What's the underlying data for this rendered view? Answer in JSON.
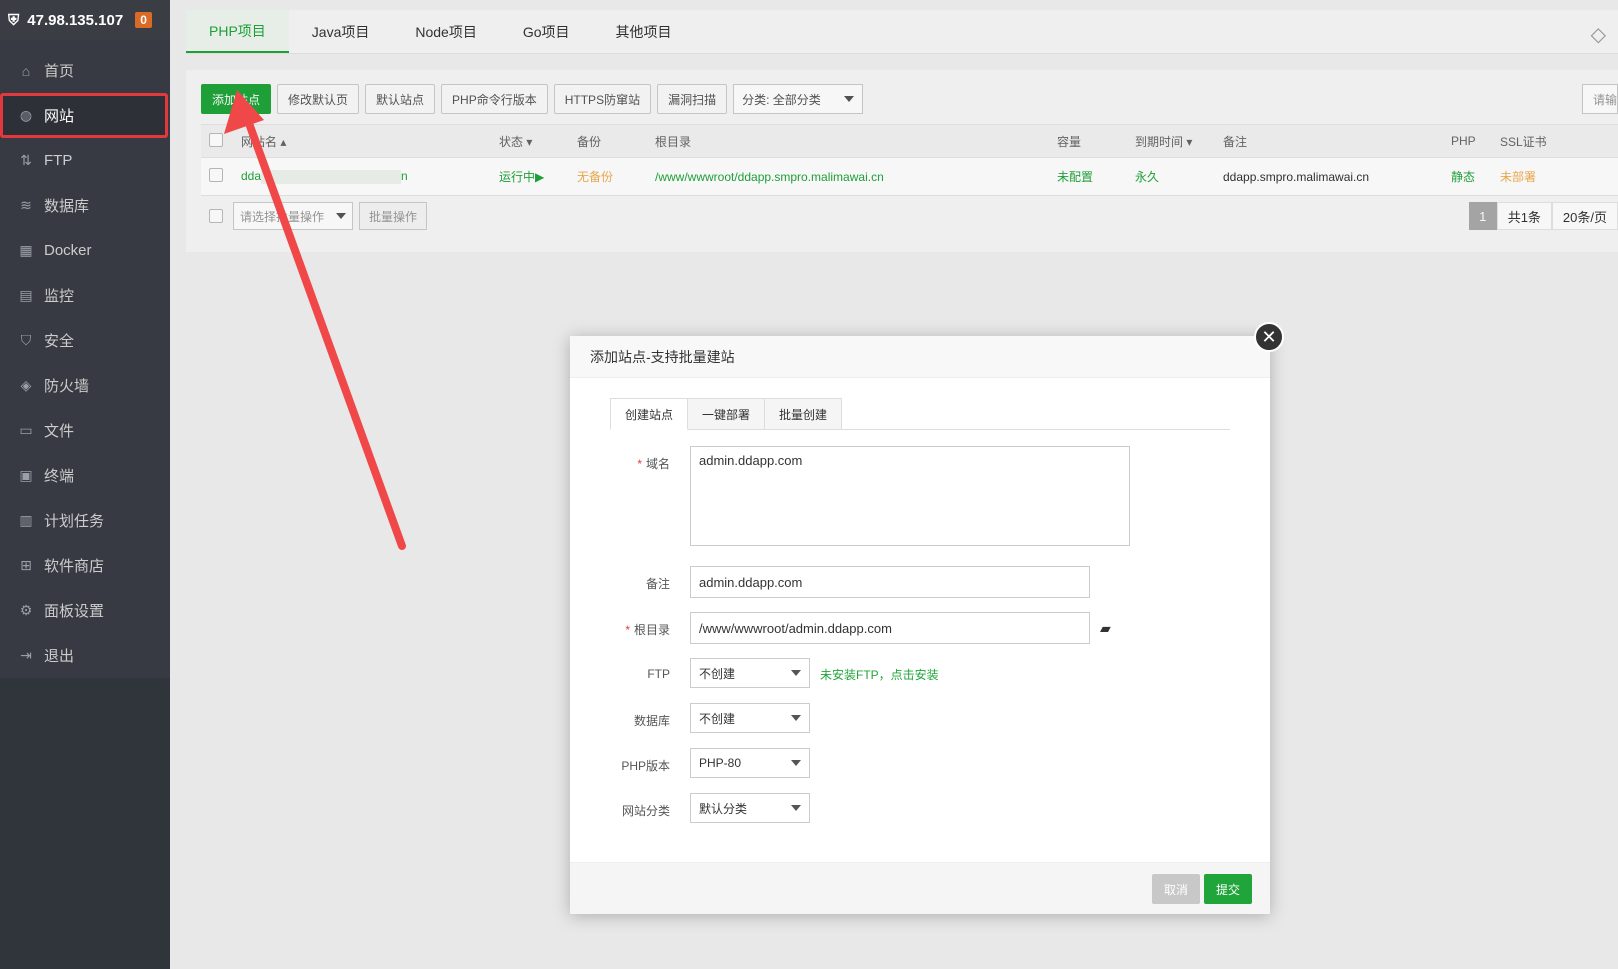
{
  "server": {
    "ip": "47.98.135.107",
    "badge": "0"
  },
  "sidebar": {
    "items": [
      {
        "label": "首页",
        "icon": "home-icon"
      },
      {
        "label": "网站",
        "icon": "globe-icon",
        "active": true
      },
      {
        "label": "FTP",
        "icon": "ftp-icon"
      },
      {
        "label": "数据库",
        "icon": "database-icon"
      },
      {
        "label": "Docker",
        "icon": "docker-icon"
      },
      {
        "label": "监控",
        "icon": "monitor-icon"
      },
      {
        "label": "安全",
        "icon": "shield-icon"
      },
      {
        "label": "防火墙",
        "icon": "firewall-icon"
      },
      {
        "label": "文件",
        "icon": "folder-icon"
      },
      {
        "label": "终端",
        "icon": "terminal-icon"
      },
      {
        "label": "计划任务",
        "icon": "calendar-icon"
      },
      {
        "label": "软件商店",
        "icon": "apps-icon"
      },
      {
        "label": "面板设置",
        "icon": "gear-icon"
      },
      {
        "label": "退出",
        "icon": "logout-icon"
      }
    ]
  },
  "tabs": [
    "PHP项目",
    "Java项目",
    "Node项目",
    "Go项目",
    "其他项目"
  ],
  "toolbar": {
    "add_site": "添加站点",
    "edit_default": "修改默认页",
    "default_site": "默认站点",
    "php_cli": "PHP命令行版本",
    "https_guard": "HTTPS防窜站",
    "vuln_scan": "漏洞扫描",
    "category": "分类: 全部分类",
    "search_placeholder": "请输"
  },
  "table": {
    "headers": {
      "name": "网站名",
      "status": "状态",
      "backup": "备份",
      "root": "根目录",
      "capacity": "容量",
      "expire": "到期时间",
      "note": "备注",
      "php": "PHP",
      "ssl": "SSL证书"
    },
    "row": {
      "name_start": "dda",
      "name_end": "n",
      "status": "运行中▶",
      "backup": "无备份",
      "root": "/www/wwwroot/ddapp.smpro.malimawai.cn",
      "capacity": "未配置",
      "expire": "永久",
      "note": "ddapp.smpro.malimawai.cn",
      "php": "静态",
      "ssl": "未部署"
    }
  },
  "batch": {
    "select_placeholder": "请选择批量操作",
    "button": "批量操作"
  },
  "pager": {
    "current": "1",
    "total": "共1条",
    "per_page": "20条/页"
  },
  "modal": {
    "title": "添加站点-支持批量建站",
    "tabs": [
      "创建站点",
      "一键部署",
      "批量创建"
    ],
    "fields": {
      "domain_label": "域名",
      "domain_value": "admin.ddapp.com",
      "note_label": "备注",
      "note_value": "admin.ddapp.com",
      "root_label": "根目录",
      "root_value": "/www/wwwroot/admin.ddapp.com",
      "ftp_label": "FTP",
      "ftp_value": "不创建",
      "ftp_hint": "未安装FTP，点击安装",
      "db_label": "数据库",
      "db_value": "不创建",
      "php_label": "PHP版本",
      "php_value": "PHP-80",
      "category_label": "网站分类",
      "category_value": "默认分类"
    },
    "cancel": "取消",
    "submit": "提交"
  },
  "colors": {
    "accent": "#20a53a",
    "highlight": "#e4393c",
    "warning": "#f0ad4e"
  }
}
